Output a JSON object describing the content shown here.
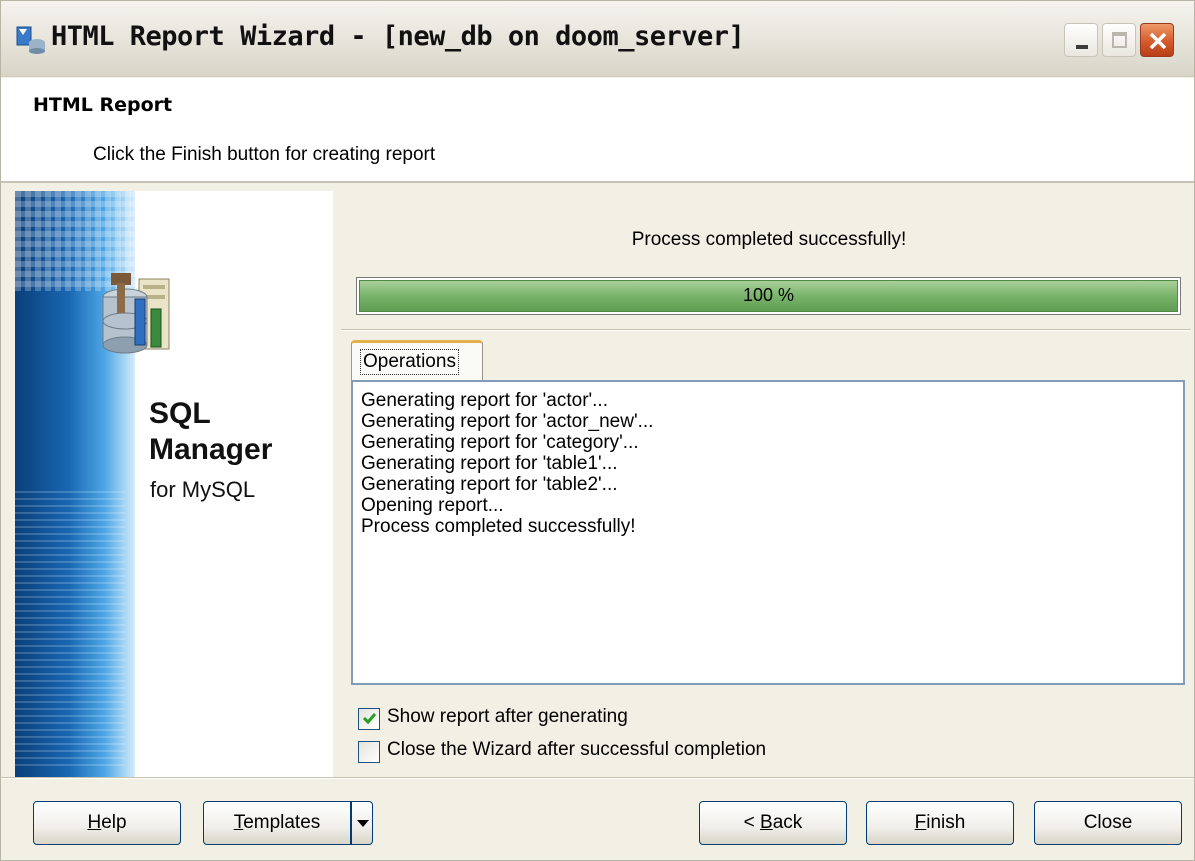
{
  "window": {
    "title": "HTML Report Wizard - [new_db on doom_server]",
    "controls": {
      "minimize_icon": "minimize-icon",
      "maximize_icon": "maximize-icon",
      "close_icon": "close-icon"
    }
  },
  "header": {
    "title": "HTML Report",
    "subtitle": "Click the Finish button for creating report"
  },
  "banner": {
    "line1": "SQL",
    "line2": "Manager",
    "line3": "for MySQL"
  },
  "status": {
    "message": "Process completed successfully!",
    "progress_value": 100,
    "progress_label": "100 %"
  },
  "tabs": [
    {
      "label": "Operations",
      "active": true
    }
  ],
  "log": [
    "Generating report for 'actor'...",
    "Generating report for 'actor_new'...",
    "Generating report for 'category'...",
    "Generating report for 'table1'...",
    "Generating report for 'table2'...",
    "Opening report...",
    "Process completed successfully!"
  ],
  "options": {
    "show_report": {
      "label": "Show report after generating",
      "checked": true
    },
    "close_wizard": {
      "label": "Close the Wizard after successful completion",
      "checked": false
    }
  },
  "buttons": {
    "help": {
      "mnemonic": "H",
      "rest": "elp"
    },
    "templates": {
      "mnemonic": "T",
      "rest": "emplates"
    },
    "back": {
      "prefix": "< ",
      "mnemonic": "B",
      "rest": "ack"
    },
    "finish": {
      "mnemonic": "F",
      "rest": "inish"
    },
    "close": "Close"
  },
  "colors": {
    "progress_fill": "#79b46a",
    "title_close": "#d55a2c",
    "banner_blue": "#1967b3"
  }
}
